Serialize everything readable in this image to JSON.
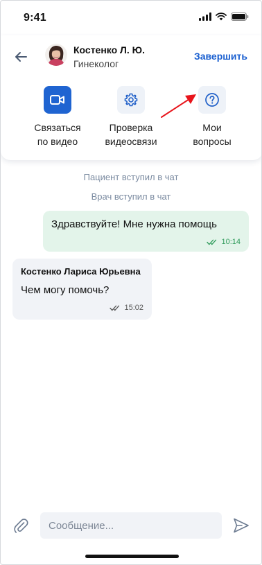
{
  "status_bar": {
    "time": "9:41",
    "icons": [
      "cellular-signal-icon",
      "wifi-icon",
      "battery-icon"
    ]
  },
  "header": {
    "back_icon": "arrow-left-icon",
    "doctor_name": "Костенко Л. Ю.",
    "doctor_role": "Гинеколог",
    "finish_label": "Завершить",
    "accent_color": "#1a5fd0",
    "annotation_color": "#e8141b"
  },
  "actions": [
    {
      "label": "Связаться\nпо видео",
      "icon": "video-camera-icon",
      "primary": true
    },
    {
      "label": "Проверка\nвидеосвязи",
      "icon": "gear-icon",
      "primary": false
    },
    {
      "label": "Мои\nвопросы",
      "icon": "question-circle-icon",
      "primary": false
    }
  ],
  "chat": {
    "system_messages": [
      "Пациент вступил в чат",
      "Врач вступил в чат"
    ],
    "outgoing": {
      "text": "Здравствуйте! Мне нужна помощь",
      "time": "10:14",
      "status_icon": "double-check-icon"
    },
    "incoming": {
      "sender": "Костенко Лариса Юрьевна",
      "text": "Чем могу помочь?",
      "time": "15:02",
      "status_icon": "double-check-icon"
    }
  },
  "composer": {
    "placeholder": "Сообщение...",
    "attach_icon": "paperclip-icon",
    "send_icon": "send-icon"
  }
}
